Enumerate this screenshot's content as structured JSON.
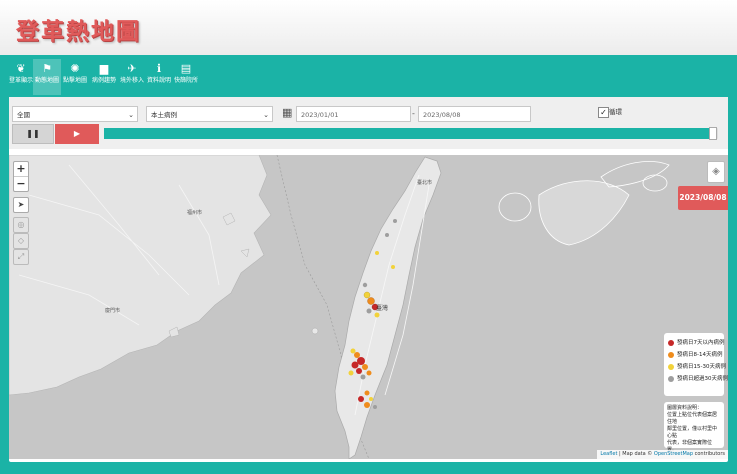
{
  "app": {
    "title": "登革熱地圖"
  },
  "nav": {
    "items": [
      {
        "label": "登革顯示",
        "icon": "mosquito-icon"
      },
      {
        "label": "動態地圖",
        "icon": "flag-icon",
        "active": true
      },
      {
        "label": "點擊地圖",
        "icon": "virus-icon"
      },
      {
        "label": "病例趨勢",
        "icon": "bar-chart-icon"
      },
      {
        "label": "境外移入",
        "icon": "airplane-icon"
      },
      {
        "label": "資料說明",
        "icon": "info-icon"
      },
      {
        "label": "快篩院所",
        "icon": "test-kit-icon"
      }
    ]
  },
  "controls": {
    "region_select": "全國",
    "case_type_select": "本土病例",
    "start_date": "2023/01/01",
    "end_date": "2023/08/08",
    "date_separator": "-",
    "loop_checked": true,
    "loop_label": "循環",
    "pause_label": "❚❚",
    "play_label": "▶",
    "timeline_progress": 0.985
  },
  "map": {
    "current_date": "2023/08/08",
    "labels": {
      "taiwan": "臺灣",
      "taipei": "臺北市",
      "fuzhou": "福州市",
      "xiamen": "廈門市"
    },
    "legend": [
      {
        "label": "發病日7天以內病例",
        "color": "#c62828"
      },
      {
        "label": "發病日8-14天病例",
        "color": "#ef8c1c"
      },
      {
        "label": "發病日15-30天病例",
        "color": "#f2d23a"
      },
      {
        "label": "發病日超過30天病例",
        "color": "#9e9e9e"
      }
    ],
    "note_lines": [
      "圖層資料說明：",
      "位置上點位代表個案居住地",
      "鄰里位置，僅以村里中心點",
      "代表，非個案實際位置。"
    ],
    "attribution": {
      "leaflet": "Leaflet",
      "sep": " | Map data © ",
      "osm": "OpenStreetMap",
      "suffix": " contributors"
    }
  }
}
